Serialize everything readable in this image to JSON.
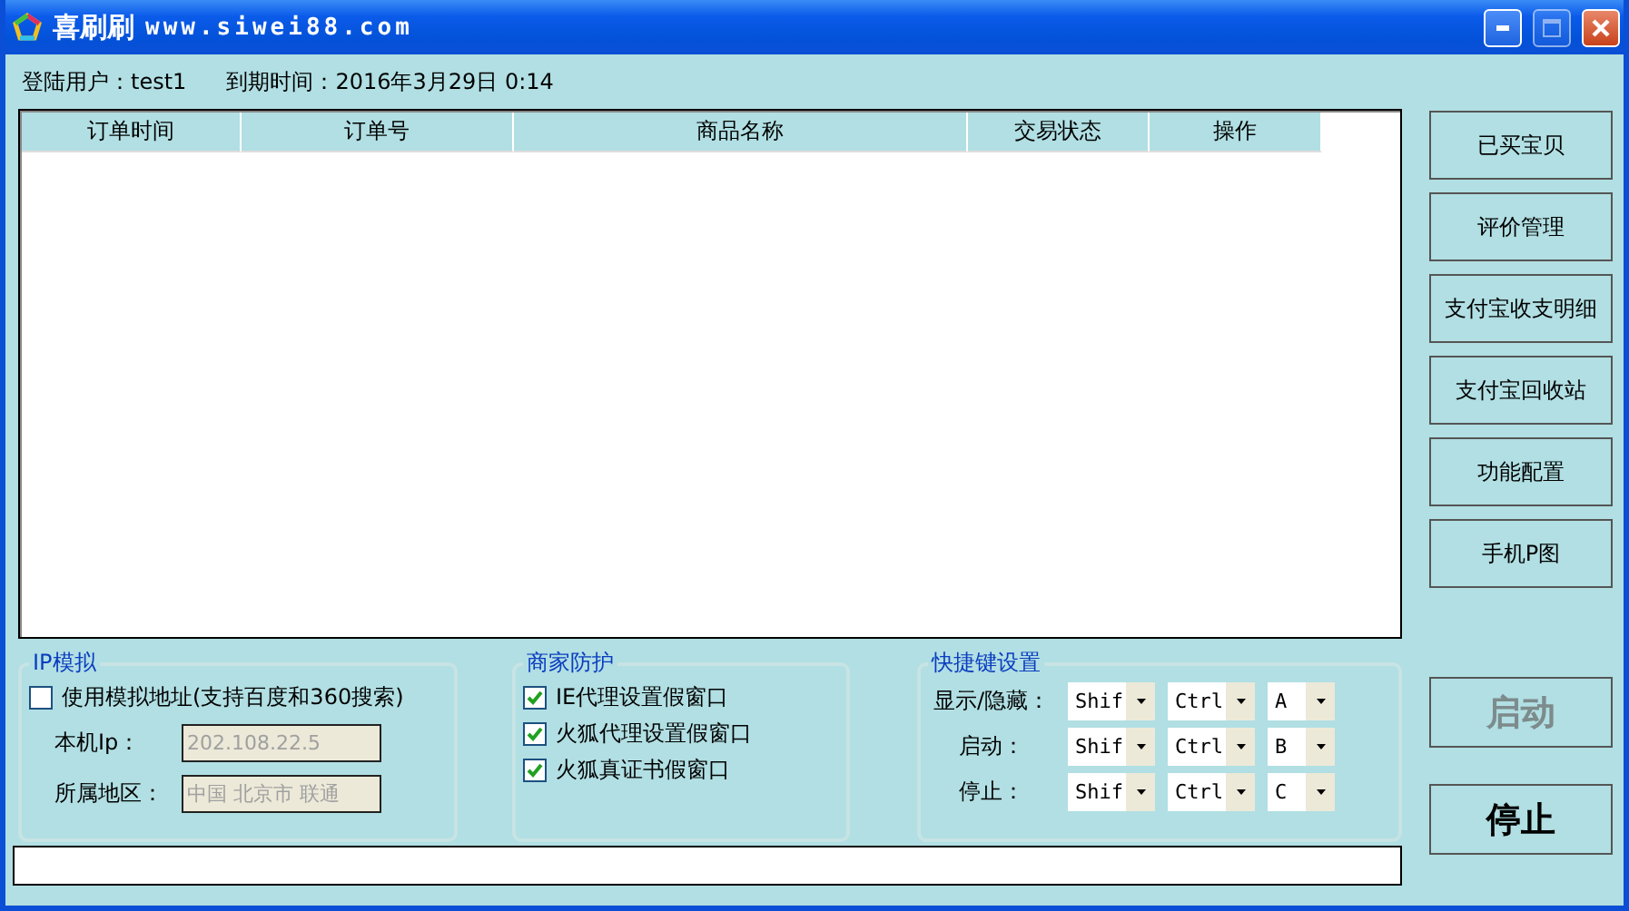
{
  "window": {
    "title": "喜刷刷",
    "subtitle": "www.siwei88.com"
  },
  "info": [
    "登陆用户：test1",
    "到期时间：2016年3月29日 0:14"
  ],
  "table": {
    "columns": [
      "订单时间",
      "订单号",
      "商品名称",
      "交易状态",
      "操作"
    ]
  },
  "side_buttons": [
    "已买宝贝",
    "评价管理",
    "支付宝收支明细",
    "支付宝回收站",
    "功能配置",
    "手机P图"
  ],
  "ip_group": {
    "title": "IP模拟",
    "option": {
      "label": "使用模拟地址(支持百度和360搜索)",
      "checked": false
    },
    "fields": [
      {
        "label": "本机Ip：",
        "value": "202.108.22.5",
        "disabled": true
      },
      {
        "label": "所属地区：",
        "value": "中国 北京市 联通",
        "disabled": true
      }
    ]
  },
  "merchant_group": {
    "title": "商家防护",
    "options": [
      {
        "label": "IE代理设置假窗口",
        "checked": true
      },
      {
        "label": "火狐代理设置假窗口",
        "checked": true
      },
      {
        "label": "火狐真证书假窗口",
        "checked": true
      }
    ]
  },
  "hotkey_group": {
    "title": "快捷键设置",
    "rows": [
      {
        "label": "显示/隐藏：",
        "keys": [
          "Shif",
          "Ctrl",
          "A"
        ]
      },
      {
        "label": "启动：",
        "keys": [
          "Shif",
          "Ctrl",
          "B"
        ]
      },
      {
        "label": "停止：",
        "keys": [
          "Shif",
          "Ctrl",
          "C"
        ]
      }
    ]
  },
  "start_button": {
    "label": "启动",
    "disabled": true
  },
  "stop_button": {
    "label": "停止",
    "disabled": false
  }
}
